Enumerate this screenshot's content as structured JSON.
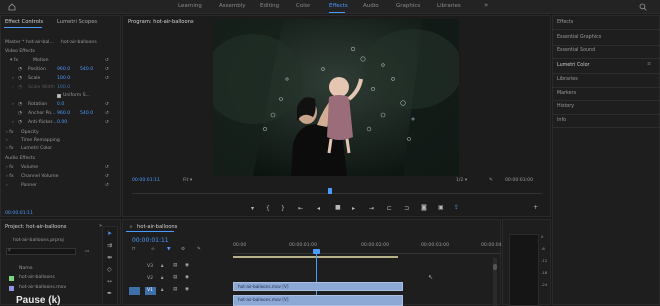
{
  "workspaces": [
    "Learning",
    "Assembly",
    "Editing",
    "Color",
    "Effects",
    "Audio",
    "Graphics",
    "Libraries"
  ],
  "active_workspace": "Effects",
  "effect_controls": {
    "tabs": [
      "Effect Controls",
      "Lumetri Scopes"
    ],
    "source": "Master * hot-air-bal...",
    "clip": "hot-air-balloons",
    "section_video": "Video Effects",
    "motion": "Motion",
    "position_label": "Position",
    "position_x": "960.0",
    "position_y": "540.0",
    "scale_label": "Scale",
    "scale_value": "100.0",
    "scale_width_label": "Scale Width",
    "scale_width_value": "100.0",
    "uniform_scale": "Uniform S...",
    "rotation_label": "Rotation",
    "rotation_value": "0.0",
    "anchor_label": "Anchor Po...",
    "anchor_x": "960.0",
    "anchor_y": "540.0",
    "antiflicker_label": "Anti-flicker...",
    "antiflicker_value": "0.00",
    "opacity": "Opacity",
    "time_remapping": "Time Remapping",
    "lumetri": "Lumetri Color",
    "section_audio": "Audio Effects",
    "volume": "Volume",
    "channel_volume": "Channel Volume",
    "panner": "Panner",
    "timecode": "00:00:01:11"
  },
  "program": {
    "title": "Program: hot-air-balloons",
    "timecode": "00:00:01:11",
    "fit": "Fit",
    "quality": "1/2",
    "duration": "00:00:03:00"
  },
  "right_panel": {
    "items": [
      "Effects",
      "Essential Graphics",
      "Essential Sound",
      "Lumetri Color",
      "Libraries",
      "Markers",
      "History",
      "Info"
    ],
    "active": "Lumetri Color"
  },
  "project": {
    "tab": "Project: hot-air-balloons",
    "file": "hot-air-balloons.prproj",
    "name_header": "Name",
    "items": [
      "hot-air-balloons",
      "hot-air-balloons.mov"
    ]
  },
  "timeline": {
    "tab": "hot-air-balloons",
    "timecode": "00:00:01:11",
    "ruler": [
      "00:00",
      "00:00:01:00",
      "00:00:02:00",
      "00:00:03:00",
      "00:00:04:00"
    ],
    "tracks": [
      "V3",
      "V2",
      "V1"
    ],
    "clip_v2": "hot-air-balloons.mov [V]",
    "clip_v1": "hot-air-balloons.mov [V]"
  },
  "caption": "Pause (k)",
  "colors": {
    "accent": "#4a9bff",
    "bg": "#1a1a1a",
    "panel": "#1e1e1e",
    "clip": "#8ca9d6"
  }
}
